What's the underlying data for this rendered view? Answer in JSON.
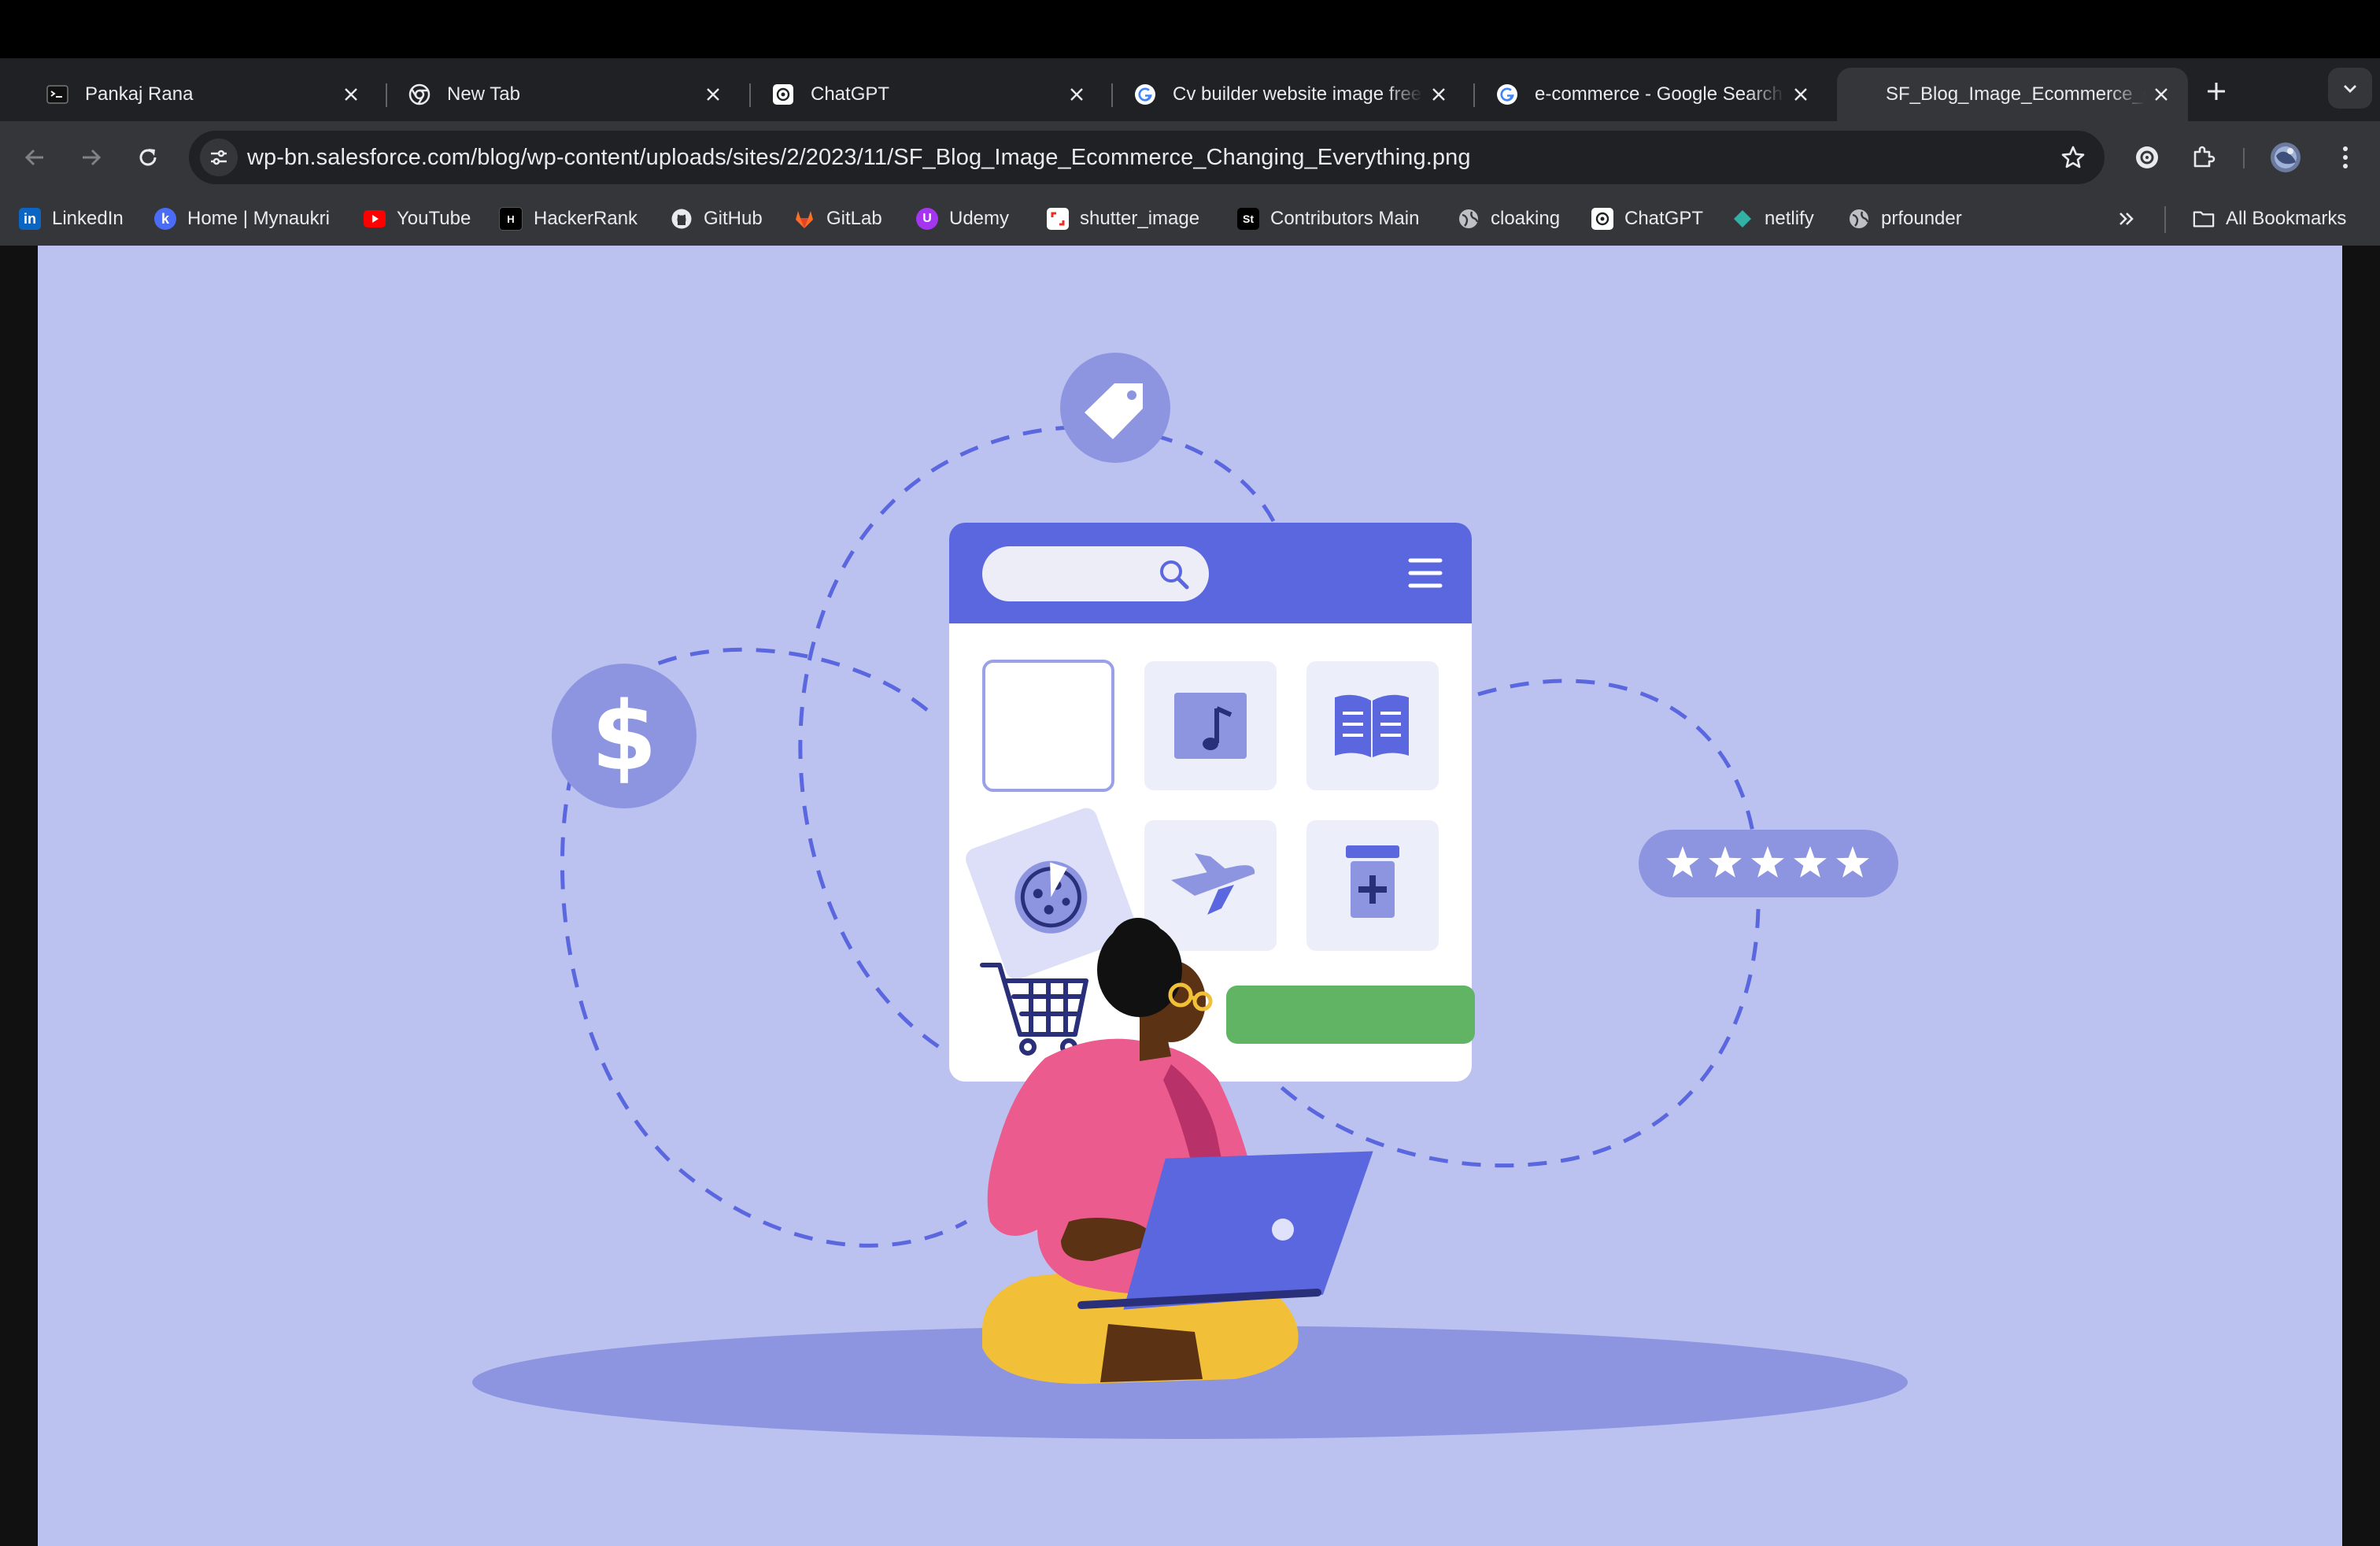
{
  "browser": {
    "tabs": [
      {
        "title": "Pankaj Rana",
        "favicon": "terminal-favicon",
        "active": false
      },
      {
        "title": "New Tab",
        "favicon": "chrome-icon",
        "active": false
      },
      {
        "title": "ChatGPT",
        "favicon": "openai-icon",
        "active": false
      },
      {
        "title": "Cv builder website image free",
        "favicon": "google-icon",
        "active": false
      },
      {
        "title": "e-commerce - Google Search",
        "favicon": "google-icon",
        "active": false
      },
      {
        "title": "SF_Blog_Image_Ecommerce_Changing_Everything.png",
        "favicon": "none",
        "active": true
      }
    ],
    "url": "wp-bn.salesforce.com/blog/wp-content/uploads/sites/2/2023/11/SF_Blog_Image_Ecommerce_Changing_Everything.png",
    "bookmarks": [
      {
        "label": "LinkedIn",
        "icon": "linkedin-icon",
        "color": "#0a66c2"
      },
      {
        "label": "Home | Mynaukri",
        "icon": "mynaukri-icon",
        "color": "#4a6cf7"
      },
      {
        "label": "YouTube",
        "icon": "youtube-icon",
        "color": "#ff0000"
      },
      {
        "label": "HackerRank",
        "icon": "hackerrank-icon",
        "color": "#000000"
      },
      {
        "label": "GitHub",
        "icon": "github-icon",
        "color": "#ffffff"
      },
      {
        "label": "GitLab",
        "icon": "gitlab-icon",
        "color": "#fc6d26"
      },
      {
        "label": "Udemy",
        "icon": "udemy-icon",
        "color": "#a435f0"
      },
      {
        "label": "shutter_image",
        "icon": "shutterstock-icon",
        "color": "#ee2b24"
      },
      {
        "label": "Contributors Main",
        "icon": "contributors-icon",
        "color": "#000000"
      },
      {
        "label": "cloaking",
        "icon": "globe-icon",
        "color": "#bdc1c6"
      },
      {
        "label": "ChatGPT",
        "icon": "openai-icon",
        "color": "#ffffff"
      },
      {
        "label": "netlify",
        "icon": "netlify-icon",
        "color": "#32b1a6"
      },
      {
        "label": "prfounder",
        "icon": "globe-icon",
        "color": "#bdc1c6"
      }
    ],
    "all_bookmarks_label": "All Bookmarks"
  },
  "illustration": {
    "rating_stars": 5,
    "colors": {
      "background": "#bcc2f0",
      "accent": "#5b67de",
      "bubble": "#8d95e1",
      "card": "#ffffff",
      "button": "#62b465",
      "shirt": "#ec5b8d",
      "pants": "#f2c038",
      "skin": "#5b3213"
    }
  }
}
